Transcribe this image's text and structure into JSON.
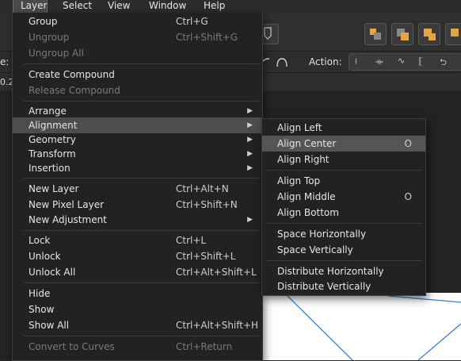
{
  "menubar": {
    "items": [
      {
        "label": "Layer"
      },
      {
        "label": "Select"
      },
      {
        "label": "View"
      },
      {
        "label": "Window"
      },
      {
        "label": "Help"
      }
    ]
  },
  "context_toolbar": {
    "left_cut_label": "e:",
    "action_label": "Action:",
    "value_field": "0.2"
  },
  "layer_menu": {
    "items": [
      {
        "label": "Group",
        "shortcut": "Ctrl+G"
      },
      {
        "label": "Ungroup",
        "shortcut": "Ctrl+Shift+G"
      },
      {
        "label": "Ungroup All",
        "shortcut": ""
      },
      {
        "label": "Create Compound",
        "shortcut": ""
      },
      {
        "label": "Release Compound",
        "shortcut": ""
      },
      {
        "label": "Arrange",
        "shortcut": ""
      },
      {
        "label": "Alignment",
        "shortcut": ""
      },
      {
        "label": "Geometry",
        "shortcut": ""
      },
      {
        "label": "Transform",
        "shortcut": ""
      },
      {
        "label": "Insertion",
        "shortcut": ""
      },
      {
        "label": "New Layer",
        "shortcut": "Ctrl+Alt+N"
      },
      {
        "label": "New Pixel Layer",
        "shortcut": "Ctrl+Shift+N"
      },
      {
        "label": "New Adjustment",
        "shortcut": ""
      },
      {
        "label": "Lock",
        "shortcut": "Ctrl+L"
      },
      {
        "label": "Unlock",
        "shortcut": "Ctrl+Shift+L"
      },
      {
        "label": "Unlock All",
        "shortcut": "Ctrl+Alt+Shift+L"
      },
      {
        "label": "Hide",
        "shortcut": ""
      },
      {
        "label": "Show",
        "shortcut": ""
      },
      {
        "label": "Show All",
        "shortcut": "Ctrl+Alt+Shift+H"
      },
      {
        "label": "Convert to Curves",
        "shortcut": "Ctrl+Return"
      }
    ]
  },
  "alignment_submenu": {
    "items": [
      {
        "label": "Align Left",
        "shortcut": ""
      },
      {
        "label": "Align Center",
        "shortcut": "O"
      },
      {
        "label": "Align Right",
        "shortcut": ""
      },
      {
        "label": "Align Top",
        "shortcut": ""
      },
      {
        "label": "Align Middle",
        "shortcut": "O"
      },
      {
        "label": "Align Bottom",
        "shortcut": ""
      },
      {
        "label": "Space Horizontally",
        "shortcut": ""
      },
      {
        "label": "Space Vertically",
        "shortcut": ""
      },
      {
        "label": "Distribute Horizontally",
        "shortcut": ""
      },
      {
        "label": "Distribute Vertically",
        "shortcut": ""
      }
    ]
  },
  "colors": {
    "menu_bg": "#222222",
    "highlight": "#4d4d4d",
    "disabled_text": "#7a7a7a",
    "canvas_stroke": "#3d7fd9"
  }
}
